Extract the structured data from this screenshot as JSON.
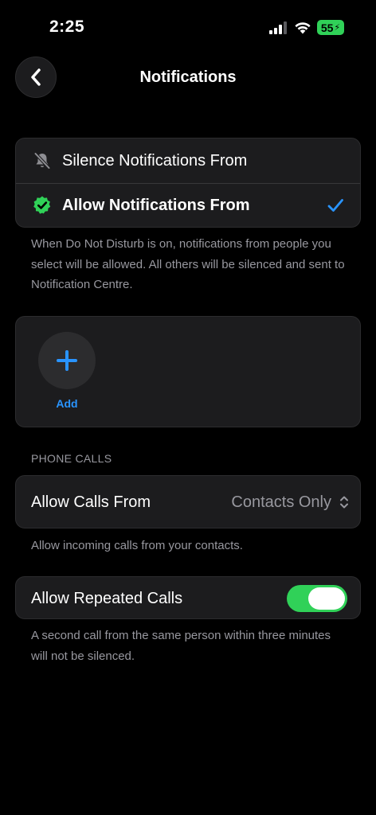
{
  "status_bar": {
    "time": "2:25",
    "battery": "55"
  },
  "nav": {
    "title": "Notifications"
  },
  "notify_mode": {
    "silence_label": "Silence Notifications From",
    "allow_label": "Allow Notifications From",
    "selected": "allow",
    "footnote": "When Do Not Disturb is on, notifications from people you select will be allowed. All others will be silenced and sent to Notification Centre."
  },
  "people": {
    "add_label": "Add"
  },
  "phone_calls": {
    "section_header": "PHONE CALLS",
    "allow_calls_label": "Allow Calls From",
    "allow_calls_value": "Contacts Only",
    "allow_calls_footnote": "Allow incoming calls from your contacts.",
    "repeated_calls_label": "Allow Repeated Calls",
    "repeated_calls_enabled": true,
    "repeated_calls_footnote": "A second call from the same person within three minutes will not be silenced."
  },
  "colors": {
    "background": "#000000",
    "card": "#1c1c1e",
    "accent_blue": "#2994ff",
    "toggle_on": "#30d158",
    "secondary_text": "#98989f"
  }
}
